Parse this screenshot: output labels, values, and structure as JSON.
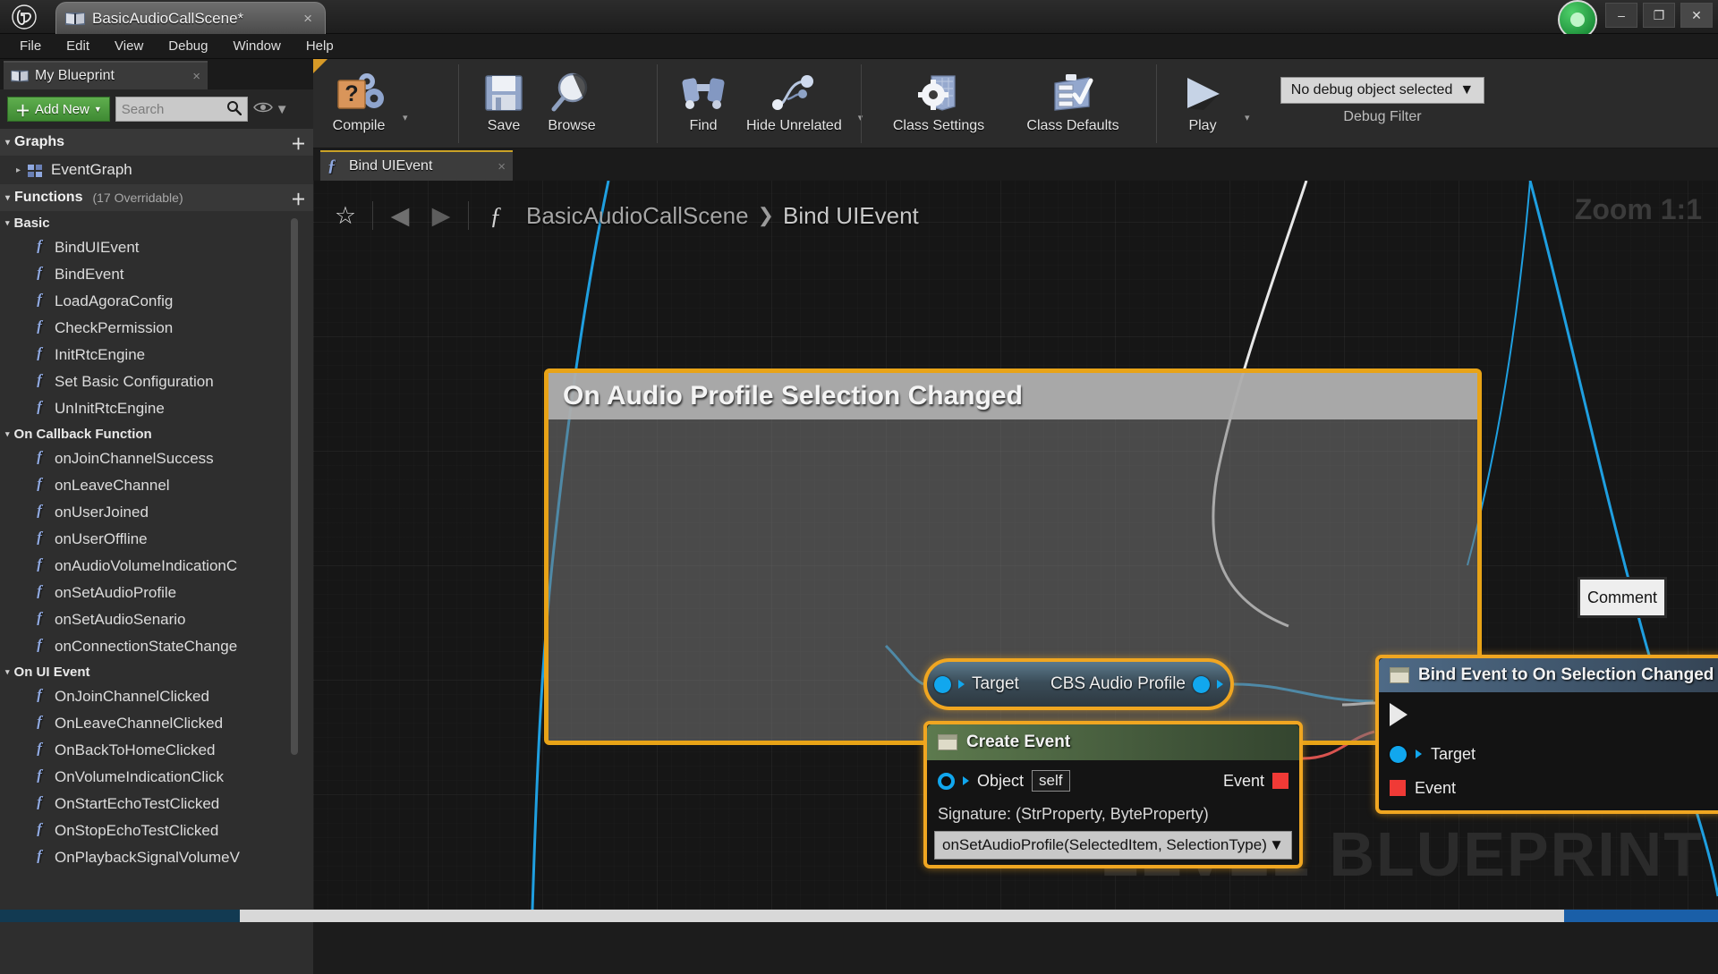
{
  "titlebar": {
    "logo": "ue-logo",
    "tab_label": "BasicAudioCallScene*",
    "tab_close": "×",
    "minimize": "–",
    "maximize": "❐",
    "close": "✕"
  },
  "menubar": {
    "items": [
      "File",
      "Edit",
      "View",
      "Debug",
      "Window",
      "Help"
    ]
  },
  "left_panel": {
    "tab_label": "My Blueprint",
    "tab_close": "×",
    "add_new_label": "Add New",
    "add_new_plus": "＋",
    "add_new_caret": "▼",
    "search_placeholder": "Search",
    "search_value": "",
    "eye_caret": "▼",
    "graphs_header": "Graphs",
    "graphs_add": "＋",
    "graph_item": "EventGraph",
    "functions_header": "Functions",
    "functions_sub": "(17 Overridable)",
    "functions_add": "＋",
    "categories": [
      {
        "name": "Basic",
        "items": [
          "BindUIEvent",
          "BindEvent",
          "LoadAgoraConfig",
          "CheckPermission",
          "InitRtcEngine",
          "Set Basic Configuration",
          "UnInitRtcEngine"
        ]
      },
      {
        "name": "On Callback Function",
        "items": [
          "onJoinChannelSuccess",
          "onLeaveChannel",
          "onUserJoined",
          "onUserOffline",
          "onAudioVolumeIndicationC",
          "onSetAudioProfile",
          "onSetAudioSenario",
          "onConnectionStateChange"
        ]
      },
      {
        "name": "On UI Event",
        "items": [
          "OnJoinChannelClicked",
          "OnLeaveChannelClicked",
          "OnBackToHomeClicked",
          "OnVolumeIndicationClick",
          "OnStartEchoTestClicked",
          "OnStopEchoTestClicked",
          "OnPlaybackSignalVolumeV"
        ]
      }
    ]
  },
  "toolbar": {
    "buttons": [
      {
        "label": "Compile",
        "icon": "compile-question-gears-icon",
        "has_caret": true
      },
      {
        "label": "Save",
        "icon": "floppy-disk-icon",
        "has_caret": false
      },
      {
        "label": "Browse",
        "icon": "magnifier-icon",
        "has_caret": false
      },
      {
        "label": "Find",
        "icon": "binoculars-icon",
        "has_caret": false
      },
      {
        "label": "Hide Unrelated",
        "icon": "node-graph-icon",
        "has_caret": true
      },
      {
        "label": "Class Settings",
        "icon": "gear-blueprint-icon",
        "has_caret": false
      },
      {
        "label": "Class Defaults",
        "icon": "checklist-icon",
        "has_caret": false
      },
      {
        "label": "Play",
        "icon": "play-triangle-icon",
        "has_caret": true
      }
    ],
    "debug_filter": {
      "value": "No debug object selected",
      "caret": "▼",
      "caption": "Debug Filter"
    }
  },
  "graph": {
    "tab_label": "Bind UIEvent",
    "tab_close": "×",
    "breadcrumb": {
      "star": "☆",
      "back": "◀",
      "forward": "▶",
      "fn_glyph": "ƒ",
      "root": "BasicAudioCallScene",
      "arrow": "❯",
      "current": "Bind UIEvent"
    },
    "zoom_label": "Zoom 1:1",
    "watermark": "LEVEL BLUEPRINT",
    "comment": {
      "title": "On Audio Profile Selection Changed",
      "tooltip": "Comment"
    },
    "nodes": [
      {
        "id": "target-getter",
        "left_pin_label": "Target",
        "right_pin_label": "CBS Audio Profile"
      },
      {
        "id": "create-event",
        "title": "Create Event",
        "object_label": "Object",
        "object_value": "self",
        "event_label": "Event",
        "signature": "Signature: (StrProperty, ByteProperty)",
        "dropdown_value": "onSetAudioProfile(SelectedItem, SelectionType)",
        "dropdown_caret": "▼"
      },
      {
        "id": "bind-event",
        "title": "Bind Event to On Selection Changed",
        "target_label": "Target",
        "event_label": "Event"
      }
    ]
  },
  "colors": {
    "accent_orange": "#f0a621",
    "comment_border": "#e8a317",
    "pin_blue": "#11a7ee",
    "pin_red": "#f03a36",
    "wire_blue": "#1f9fe0",
    "wire_white": "#e8e8e8",
    "wire_red": "#d9534f",
    "add_new_green": "#4f9c3f"
  }
}
